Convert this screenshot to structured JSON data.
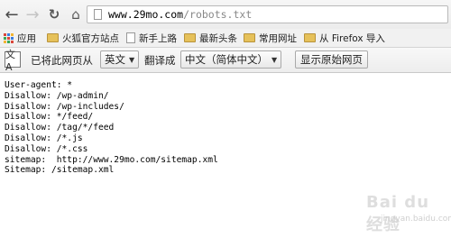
{
  "browser": {
    "url_domain": "www.29mo.com",
    "url_path": "/robots.txt"
  },
  "bookmarks": [
    {
      "label": "应用",
      "icon": "apps-icon"
    },
    {
      "label": "火狐官方站点",
      "icon": "folder-icon"
    },
    {
      "label": "新手上路",
      "icon": "page-icon"
    },
    {
      "label": "最新头条",
      "icon": "folder-icon"
    },
    {
      "label": "常用网址",
      "icon": "folder-icon"
    },
    {
      "label": "从 Firefox 导入",
      "icon": "folder-icon"
    }
  ],
  "translate": {
    "icon_glyph": "文A",
    "prefix": "已将此网页从",
    "source_language": "英文",
    "middle": "翻译成",
    "target_language": "中文（简体中文）",
    "show_original": "显示原始网页"
  },
  "content_lines": [
    "User-agent: *",
    "Disallow: /wp-admin/",
    "Disallow: /wp-includes/",
    "Disallow: */feed/",
    "Disallow: /tag/*/feed",
    "Disallow: /*.js",
    "Disallow: /*.css",
    "sitemap:  http://www.29mo.com/sitemap.xml",
    "Sitemap: /sitemap.xml"
  ],
  "watermark": {
    "logo": "Bai du 经验",
    "sub": "jingyan.baidu.com"
  }
}
